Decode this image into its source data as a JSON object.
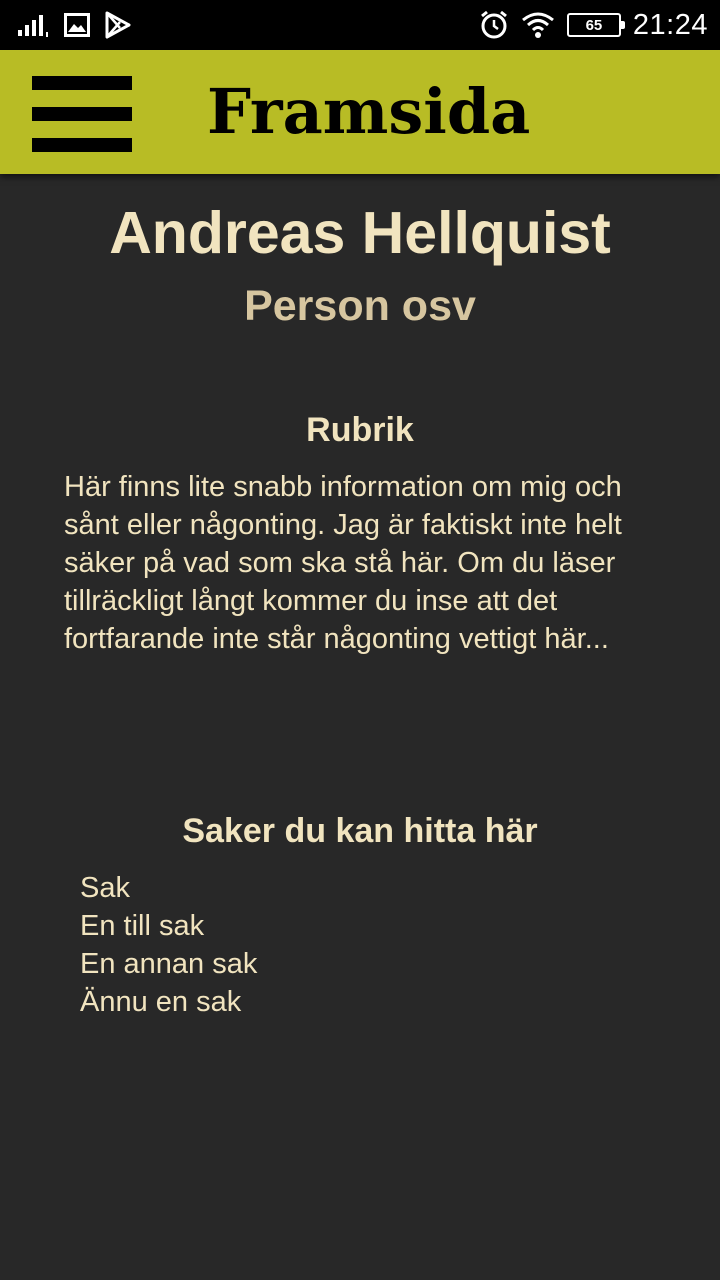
{
  "status_bar": {
    "time": "21:24",
    "battery": "65",
    "icons": [
      "signal-icon",
      "image-notification-icon",
      "play-store-icon",
      "alarm-icon",
      "wifi-icon",
      "battery-icon"
    ]
  },
  "app_bar": {
    "title": "Framsida",
    "background_color": "#b8bc25",
    "menu_icon": "hamburger-menu-icon"
  },
  "profile": {
    "name": "Andreas Hellquist",
    "subtitle": "Person osv"
  },
  "section_info": {
    "heading": "Rubrik",
    "body": "Här finns lite snabb information om mig och sånt eller någonting. Jag är faktiskt inte helt säker på vad som ska stå här. Om du läser tillräckligt långt kommer du inse att det fortfarande inte står någonting vettigt här..."
  },
  "section_items": {
    "heading": "Saker du kan hitta här",
    "items": [
      "Sak",
      "En till sak",
      "En annan sak",
      "Ännu en sak"
    ]
  },
  "colors": {
    "background": "#282828",
    "text": "#f1e4bf",
    "subtitle": "#d7c6a0"
  }
}
